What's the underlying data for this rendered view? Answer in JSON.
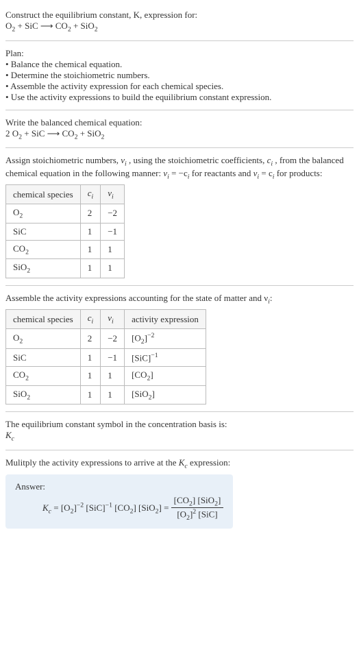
{
  "intro": {
    "line1": "Construct the equilibrium constant, K, expression for:",
    "eq_lhs_o2": "O",
    "eq_lhs_sic": " + SiC ",
    "arrow": "⟶",
    "eq_rhs_co2": " CO",
    "eq_rhs_sio2": " + SiO"
  },
  "plan": {
    "title": "Plan:",
    "b1": "• Balance the chemical equation.",
    "b2": "• Determine the stoichiometric numbers.",
    "b3": "• Assemble the activity expression for each chemical species.",
    "b4": "• Use the activity expressions to build the equilibrium constant expression."
  },
  "balanced": {
    "title": "Write the balanced chemical equation:",
    "pre_o2": "2 O",
    "sic": " + SiC ",
    "arrow": "⟶",
    "co2": " CO",
    "sio2": " + SiO"
  },
  "assign": {
    "text1": "Assign stoichiometric numbers, ",
    "nu_i": "ν",
    "text2": ", using the stoichiometric coefficients, ",
    "c_i": "c",
    "text3": ", from the balanced chemical equation in the following manner: ",
    "rel1_a": "ν",
    "rel1_b": " = −c",
    "text4": " for reactants and ",
    "rel2_a": "ν",
    "rel2_b": " = c",
    "text5": " for products:"
  },
  "table1": {
    "h1": "chemical species",
    "h2": "c",
    "h2sub": "i",
    "h3": "ν",
    "h3sub": "i",
    "r1c1": "O",
    "r1c1sub": "2",
    "r1c2": "2",
    "r1c3": "−2",
    "r2c1": "SiC",
    "r2c2": "1",
    "r2c3": "−1",
    "r3c1": "CO",
    "r3c1sub": "2",
    "r3c2": "1",
    "r3c3": "1",
    "r4c1": "SiO",
    "r4c1sub": "2",
    "r4c2": "1",
    "r4c3": "1"
  },
  "activity": {
    "text": "Assemble the activity expressions accounting for the state of matter and ν",
    "textsub": "i",
    "colon": ":"
  },
  "table2": {
    "h1": "chemical species",
    "h2": "c",
    "h3": "ν",
    "h4": "activity expression",
    "r1c1": "O",
    "r1c2": "2",
    "r1c3": "−2",
    "r1c4_a": "[O",
    "r1c4_b": "]",
    "r1c4_exp": "−2",
    "r2c1": "SiC",
    "r2c2": "1",
    "r2c3": "−1",
    "r2c4_a": "[SiC]",
    "r2c4_exp": "−1",
    "r3c1": "CO",
    "r3c2": "1",
    "r3c3": "1",
    "r3c4_a": "[CO",
    "r3c4_b": "]",
    "r4c1": "SiO",
    "r4c2": "1",
    "r4c3": "1",
    "r4c4_a": "[SiO",
    "r4c4_b": "]"
  },
  "symbol": {
    "text": "The equilibrium constant symbol in the concentration basis is:",
    "kc": "K"
  },
  "multiply": {
    "text": "Mulitply the activity expressions to arrive at the ",
    "kc": "K",
    "sub": "c",
    "text2": " expression:"
  },
  "answer": {
    "label": "Answer:",
    "kc": "K",
    "sub": "c",
    "eq": " = [O",
    "o2sub": "2",
    "o2end": "]",
    "exp1": "−2",
    "sic": " [SiC]",
    "exp2": "−1",
    "co2": " [CO",
    "co2end": "] [SiO",
    "sio2end": "] = ",
    "num_a": "[CO",
    "num_b": "] [SiO",
    "num_c": "]",
    "den_a": "[O",
    "den_b": "]",
    "den_exp": "2",
    "den_c": " [SiC]"
  },
  "chart_data": {
    "type": "table",
    "title": "Stoichiometric numbers",
    "categories": [
      "O2",
      "SiC",
      "CO2",
      "SiO2"
    ],
    "series": [
      {
        "name": "c_i",
        "values": [
          2,
          1,
          1,
          1
        ]
      },
      {
        "name": "ν_i",
        "values": [
          -2,
          -1,
          1,
          1
        ]
      }
    ]
  }
}
